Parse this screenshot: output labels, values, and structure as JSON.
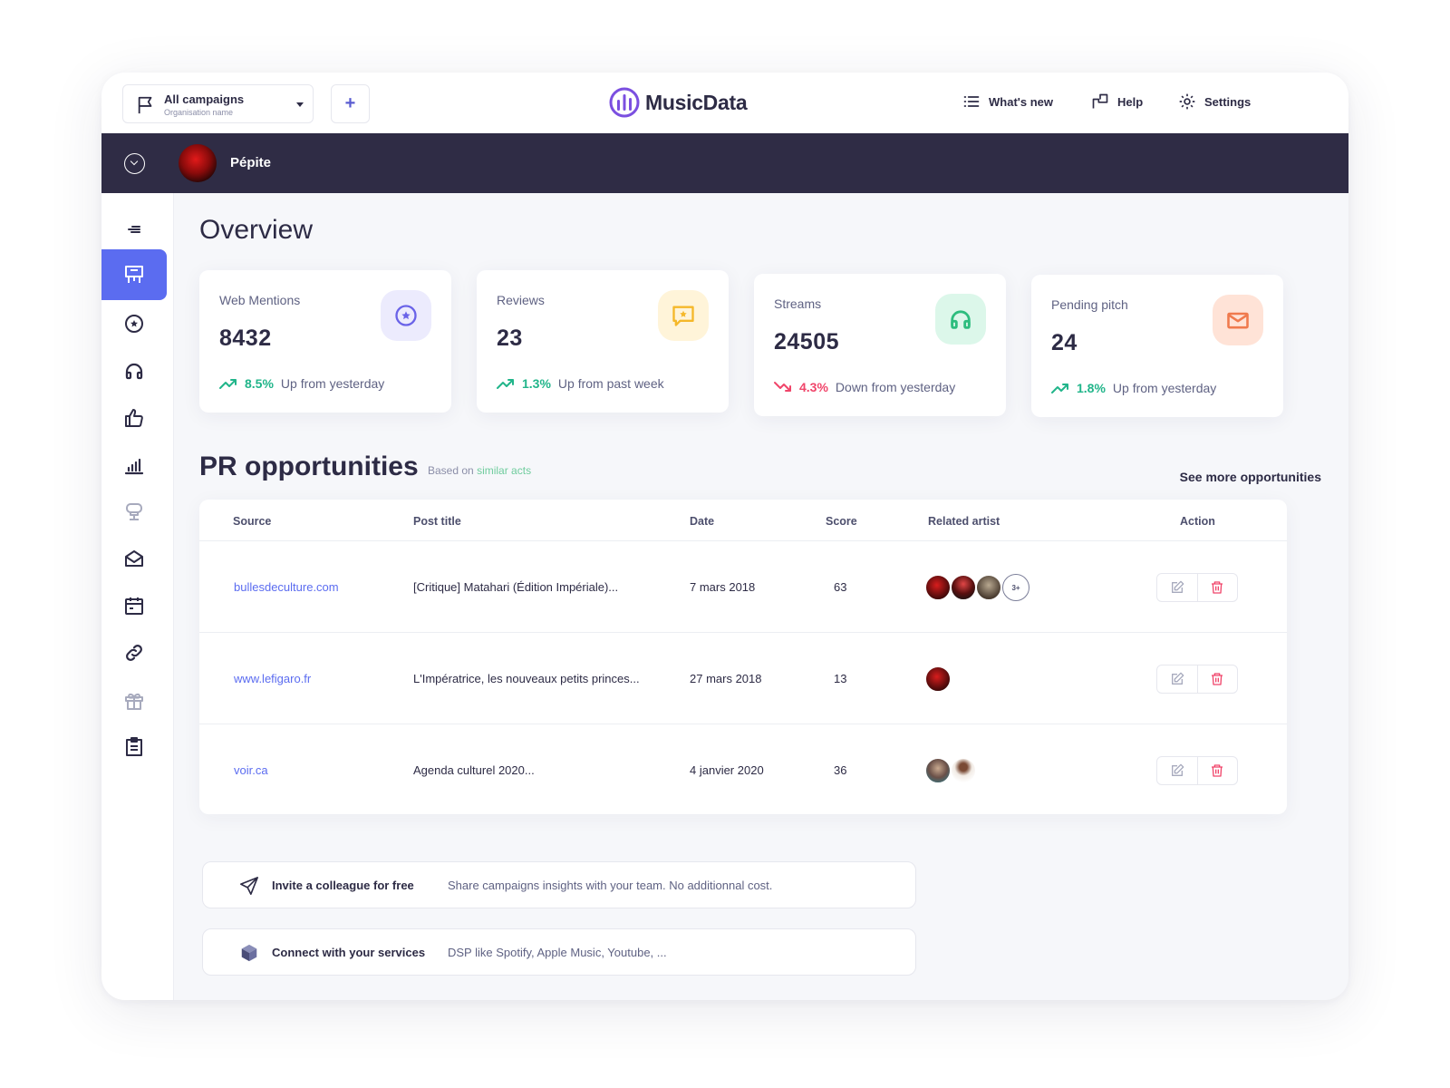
{
  "topbar": {
    "campaign_title": "All campaigns",
    "campaign_subtitle": "Organisation name",
    "add_label": "+",
    "logo_text": "MusicData",
    "nav": [
      {
        "label": "What's new",
        "icon": "list-icon"
      },
      {
        "label": "Help",
        "icon": "help-icon"
      },
      {
        "label": "Settings",
        "icon": "gear-icon"
      }
    ]
  },
  "artist": {
    "name": "Pépite"
  },
  "sidebar": {
    "items": [
      {
        "icon": "menu-icon"
      },
      {
        "icon": "presentation-icon",
        "active": true
      },
      {
        "icon": "star-circle-icon"
      },
      {
        "icon": "headphones-icon"
      },
      {
        "icon": "thumbs-up-icon"
      },
      {
        "icon": "bar-chart-icon"
      },
      {
        "icon": "chat-icon"
      },
      {
        "icon": "mail-open-icon"
      },
      {
        "icon": "calendar-icon"
      },
      {
        "icon": "link-icon"
      },
      {
        "icon": "gift-icon"
      },
      {
        "icon": "clipboard-icon"
      }
    ]
  },
  "overview": {
    "title": "Overview",
    "cards": [
      {
        "label": "Web Mentions",
        "value": "8432",
        "trend": "up",
        "pct": "8.5%",
        "desc": "Up from yesterday",
        "icon": "star-circle-icon",
        "color": "#6a63e8",
        "bg": "#ecebfd"
      },
      {
        "label": "Reviews",
        "value": "23",
        "trend": "up",
        "pct": "1.3%",
        "desc": "Up from past week",
        "icon": "review-icon",
        "color": "#f5b82a",
        "bg": "#fff4d9"
      },
      {
        "label": "Streams",
        "value": "24505",
        "trend": "down",
        "pct": "4.3%",
        "desc": "Down from yesterday",
        "icon": "headphones-icon",
        "color": "#2dbd7e",
        "bg": "#dcf7ea"
      },
      {
        "label": "Pending pitch",
        "value": "24",
        "trend": "up",
        "pct": "1.8%",
        "desc": "Up from yesterday",
        "icon": "mail-icon",
        "color": "#f07a4d",
        "bg": "#ffe3d7"
      }
    ]
  },
  "pr": {
    "title": "PR opportunities",
    "based_prefix": "Based on",
    "based_link": "similar acts",
    "see_more": "See more opportunities",
    "columns": [
      "Source",
      "Post title",
      "Date",
      "Score",
      "Related artist",
      "Action"
    ],
    "rows": [
      {
        "source": "bullesdeculture.com",
        "post": "[Critique] Matahari (Édition Impériale)...",
        "date": "7 mars 2018",
        "score": "63",
        "artists": [
          "#8b1a1a",
          "#6f1515",
          "#7b6a55"
        ],
        "more": "3+"
      },
      {
        "source": "www.lefigaro.fr",
        "post": "L'Impératrice, les nouveaux petits princes...",
        "date": "27 mars 2018",
        "score": "13",
        "artists": [
          "#8b1a1a"
        ],
        "more": ""
      },
      {
        "source": "voir.ca",
        "post": "Agenda culturel 2020...",
        "date": "4 janvier 2020",
        "score": "36",
        "artists": [
          "#8f7a70",
          "#e9e3dc"
        ],
        "more": ""
      }
    ]
  },
  "banners": [
    {
      "title": "Invite a colleague for free",
      "desc": "Share campaigns insights with your team. No additionnal cost.",
      "icon": "send-icon"
    },
    {
      "title": "Connect with your services",
      "desc": "DSP like Spotify, Apple Music, Youtube, ...",
      "icon": "cube-icon"
    }
  ],
  "colors": {
    "accent": "#5b6cf0",
    "dark_band": "#2f2c45",
    "up": "#21b58a",
    "down": "#f0456a",
    "delete": "#f0456a"
  }
}
